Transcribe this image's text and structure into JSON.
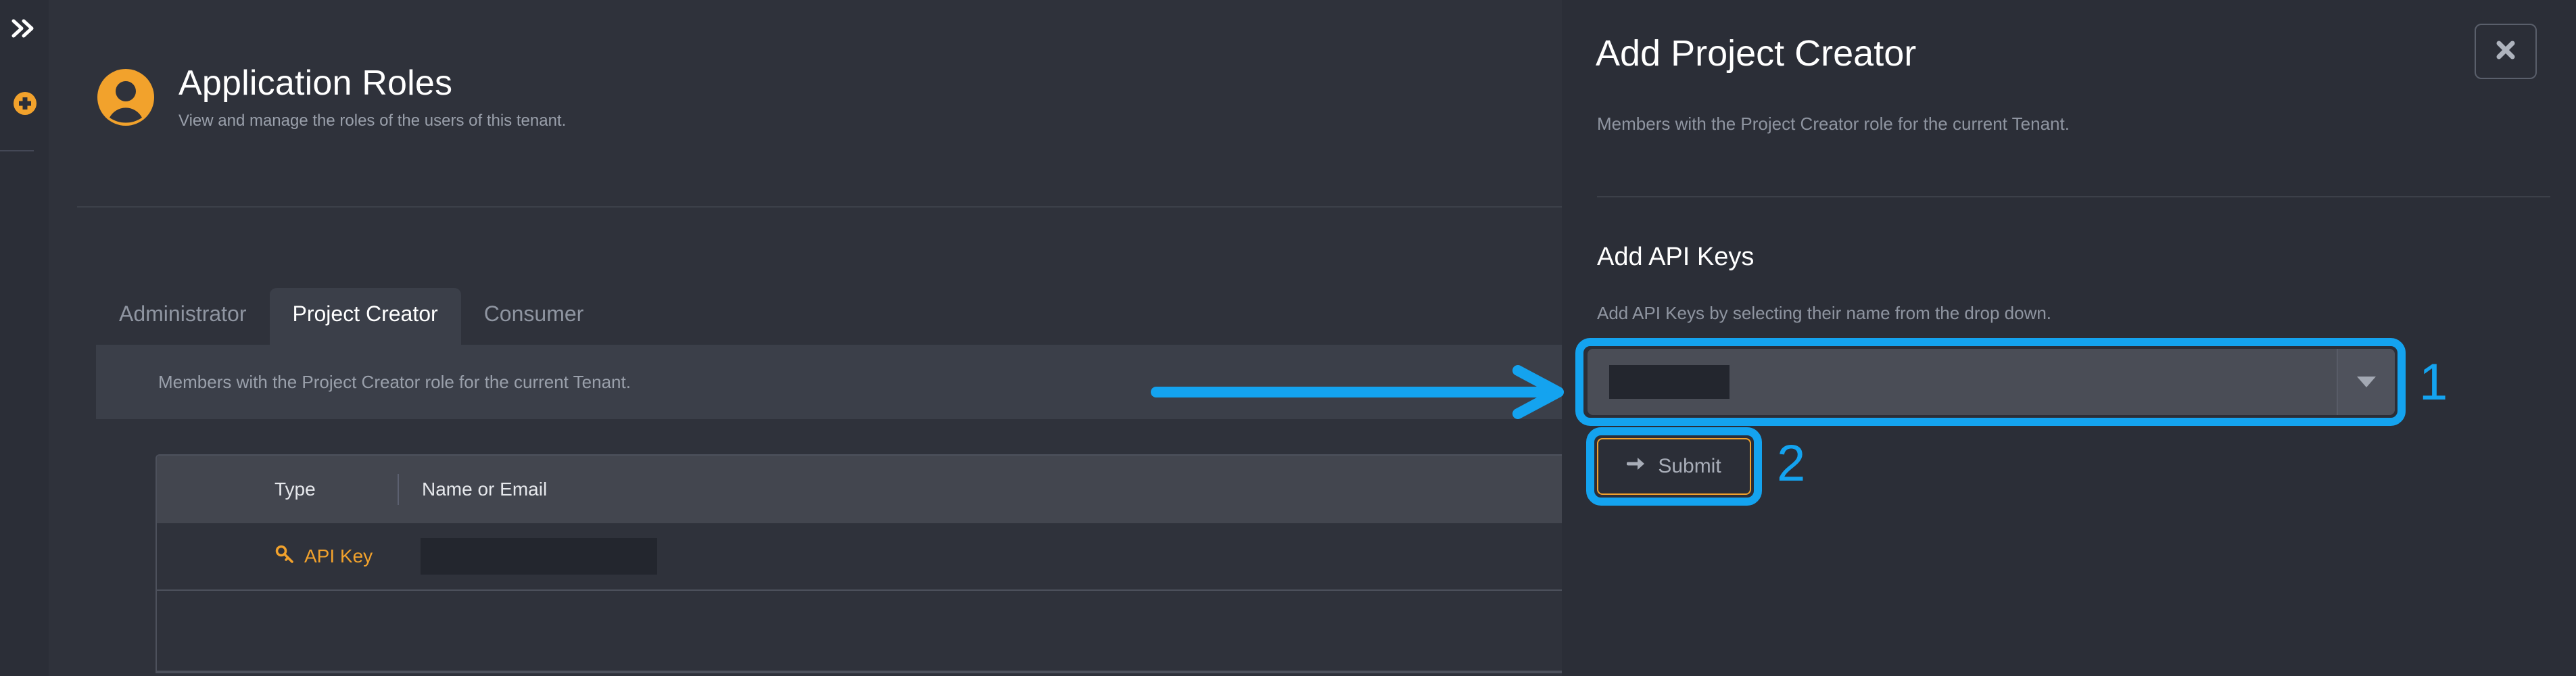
{
  "rail": {
    "expand_icon": "chevron-double-right-icon",
    "add_icon": "plus-circle-icon"
  },
  "page": {
    "avatar_icon": "user-circle-icon",
    "title": "Application Roles",
    "subtitle": "View and manage the roles of the users of this tenant."
  },
  "tabs": [
    {
      "label": "Administrator",
      "active": false
    },
    {
      "label": "Project Creator",
      "active": true
    },
    {
      "label": "Consumer",
      "active": false
    }
  ],
  "members_note": "Members with the Project Creator role for the current Tenant.",
  "table": {
    "columns": [
      "Type",
      "Name or Email"
    ],
    "rows": [
      {
        "type_icon": "key-icon",
        "type": "API Key",
        "name": "",
        "name_redacted": true
      }
    ]
  },
  "drawer": {
    "title": "Add Project Creator",
    "subtitle": "Members with the Project Creator role for the current Tenant.",
    "close_icon": "close-icon",
    "section": {
      "title": "Add API Keys",
      "subtitle": "Add API Keys by selecting their name from the drop down."
    },
    "select": {
      "value": "",
      "value_redacted": true,
      "placeholder": "",
      "caret_icon": "chevron-down-icon"
    },
    "submit": {
      "label": "Submit",
      "icon": "arrow-right-icon"
    }
  },
  "annotations": {
    "step_one": "1",
    "step_two": "2",
    "arrow_icon": "arrow-right-annotation",
    "color": "#14a3ef",
    "highlight_color": "#f2a22c"
  },
  "colors": {
    "app_background": "#2f323b",
    "rail_background": "#2b2e37",
    "drawer_background": "#2b2e37",
    "accent_orange": "#f2a22c",
    "annotation_blue": "#14a3ef",
    "table_header": "#43464f",
    "redact": "#23262e"
  }
}
